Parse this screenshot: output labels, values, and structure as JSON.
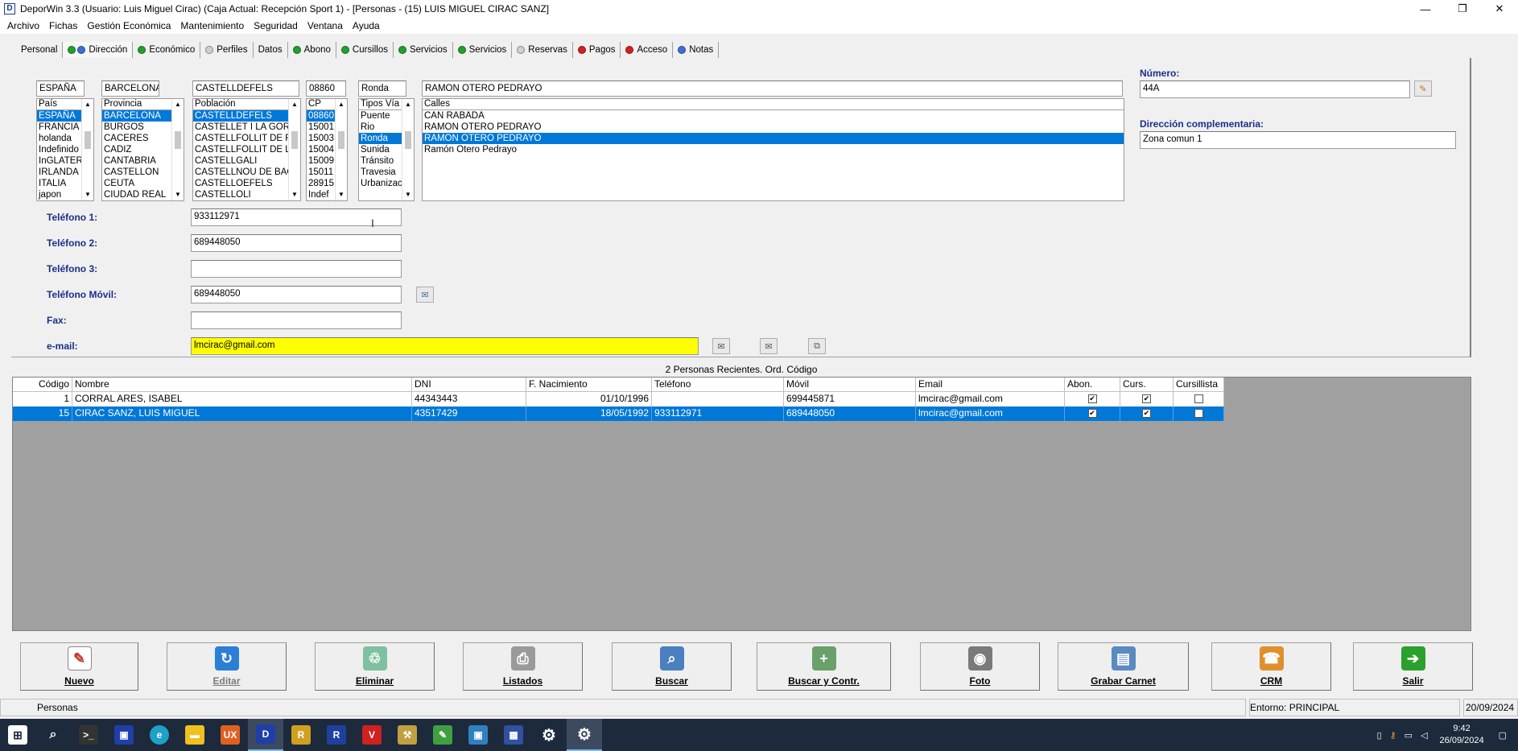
{
  "window": {
    "title": "DeporWin 3.3  (Usuario: Luis Miguel Cirac)  (Caja Actual: Recepción Sport 1) - [Personas - (15) LUIS MIGUEL CIRAC SANZ]"
  },
  "menu": [
    "Archivo",
    "Fichas",
    "Gestión Económica",
    "Mantenimiento",
    "Seguridad",
    "Ventana",
    "Ayuda"
  ],
  "tabs": [
    {
      "label": "Personal",
      "dots": []
    },
    {
      "label": "Dirección",
      "dots": [
        "#22a02a",
        "#3a6fd8"
      ],
      "active": true
    },
    {
      "label": "Económico",
      "dots": [
        "#22a02a"
      ]
    },
    {
      "label": "Perfiles",
      "dots": [
        "#d0d0d0"
      ]
    },
    {
      "label": "Datos",
      "dots": []
    },
    {
      "label": "Abono",
      "dots": [
        "#22a02a"
      ]
    },
    {
      "label": "Cursillos",
      "dots": [
        "#22a02a"
      ]
    },
    {
      "label": "Servicios",
      "dots": [
        "#22a02a"
      ]
    },
    {
      "label": "Servicios",
      "dots": [
        "#22a02a"
      ]
    },
    {
      "label": "Reservas",
      "dots": [
        "#d0d0d0"
      ]
    },
    {
      "label": "Pagos",
      "dots": [
        "#d02020"
      ]
    },
    {
      "label": "Acceso",
      "dots": [
        "#d02020"
      ]
    },
    {
      "label": "Notas",
      "dots": [
        "#3a6fd8"
      ]
    }
  ],
  "address": {
    "pais": {
      "value": "ESPAÑA",
      "header": "País",
      "items": [
        "ESPAÑA",
        "FRANCIA",
        "holanda",
        "Indefinido",
        "InGLATER",
        "IRLANDA",
        "ITALIA",
        "japon"
      ],
      "selected": 0
    },
    "provincia": {
      "value": "BARCELONA",
      "header": "Provincia",
      "items": [
        "BARCELONA",
        "BURGOS",
        "CACERES",
        "CADIZ",
        "CANTABRIA",
        "CASTELLON",
        "CEUTA",
        "CIUDAD REAL"
      ],
      "selected": 0
    },
    "poblacion": {
      "value": "CASTELLDEFELS",
      "header": "Población",
      "items": [
        "CASTELLDEFELS",
        "CASTELLET I LA GORI",
        "CASTELLFOLLIT DE R",
        "CASTELLFOLLIT DE L",
        "CASTELLGALI",
        "CASTELLNOU DE BAG",
        "CASTELLOEFELS",
        "CASTELLOLI"
      ],
      "selected": 0
    },
    "cp": {
      "value": "08860",
      "header": "CP",
      "items": [
        "08860",
        "15001",
        "15003",
        "15004",
        "15009",
        "15011",
        "28915",
        "Indef"
      ],
      "selected": 0
    },
    "tipovia": {
      "value": "Ronda",
      "header": "Tipos Vía",
      "items": [
        "Puente",
        "Rio",
        "Ronda",
        "Sunida",
        "Tránsito",
        "Travesia",
        "Urbanizac"
      ],
      "selected": 2
    },
    "calle": {
      "value": "RAMON OTERO PEDRAYO",
      "header": "Calles",
      "items": [
        "CAN RABADA",
        "RAMON OTERO PEDRAYO",
        "RAMON OTERO PEDRAYO",
        "Ramón Otero Pedrayo"
      ],
      "selected": 2
    },
    "numero_label": "Número:",
    "numero": "44A",
    "complementaria_label": "Dirección complementaria:",
    "complementaria": "Zona comun 1"
  },
  "contact": {
    "tel1_label": "Teléfono 1:",
    "tel1": "933112971",
    "tel2_label": "Teléfono 2:",
    "tel2": "689448050",
    "tel3_label": "Teléfono 3:",
    "tel3": "",
    "movil_label": "Teléfono Móvil:",
    "movil": "689448050",
    "fax_label": "Fax:",
    "fax": "",
    "email_label": "e-mail:",
    "email": "lmcirac@gmail.com"
  },
  "recent": {
    "title": "2 Personas Recientes. Ord. Código",
    "columns": [
      "Código",
      "Nombre",
      "DNI",
      "F. Nacimiento",
      "Teléfono",
      "Móvil",
      "Email",
      "Abon.",
      "Curs.",
      "Cursillista"
    ],
    "rows": [
      {
        "codigo": "1",
        "nombre": "CORRAL ARES, ISABEL",
        "dni": "44343443",
        "nacimiento": "01/10/1996",
        "telefono": "",
        "movil": "699445871",
        "email": "lmcirac@gmail.com",
        "abon": true,
        "curs": true,
        "cursillista": false
      },
      {
        "codigo": "15",
        "nombre": "CIRAC SANZ, LUIS MIGUEL",
        "dni": "43517429",
        "nacimiento": "18/05/1992",
        "telefono": "933112971",
        "movil": "689448050",
        "email": "lmcirac@gmail.com",
        "abon": true,
        "curs": true,
        "cursillista": false
      }
    ]
  },
  "toolbar": {
    "nuevo": "Nuevo",
    "editar": "Editar",
    "eliminar": "Eliminar",
    "listados": "Listados",
    "buscar": "Buscar",
    "buscar_contr": "Buscar y Contr.",
    "foto": "Foto",
    "grabar_carnet": "Grabar Carnet",
    "crm": "CRM",
    "salir": "Salir"
  },
  "status": {
    "left": "Personas",
    "entorno": "Entorno: PRINCIPAL",
    "date": "20/09/2024"
  },
  "taskbar": {
    "time": "9:42",
    "date": "26/09/2024"
  }
}
